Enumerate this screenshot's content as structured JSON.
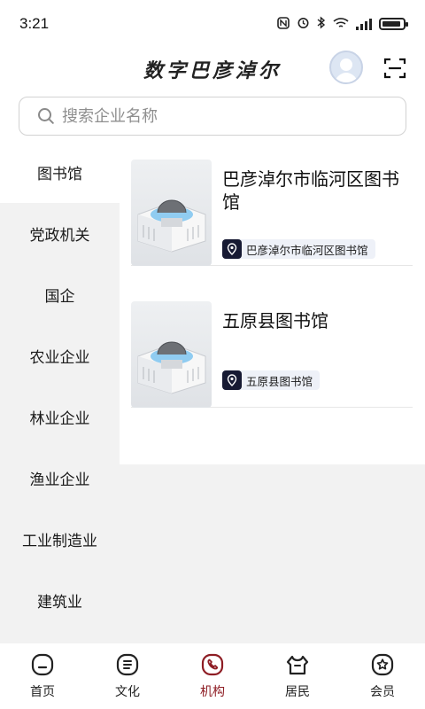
{
  "status_bar": {
    "time": "3:21",
    "battery_level": 0.9
  },
  "header": {
    "title": "数字巴彦淖尔"
  },
  "search": {
    "placeholder": "搜索企业名称"
  },
  "sidebar": {
    "items": [
      {
        "label": "图书馆",
        "active": true
      },
      {
        "label": "党政机关"
      },
      {
        "label": "国企"
      },
      {
        "label": "农业企业"
      },
      {
        "label": "林业企业"
      },
      {
        "label": "渔业企业"
      },
      {
        "label": "工业制造业"
      },
      {
        "label": "建筑业"
      }
    ]
  },
  "list": {
    "items": [
      {
        "title": "巴彦淖尔市临河区图书馆",
        "tag": "巴彦淖尔市临河区图书馆",
        "image": "library-building-image"
      },
      {
        "title": "五原县图书馆",
        "tag": "五原县图书馆",
        "image": "library-building-image"
      }
    ]
  },
  "bottom_nav": {
    "items": [
      {
        "label": "首页",
        "icon": "home-icon"
      },
      {
        "label": "文化",
        "icon": "document-icon"
      },
      {
        "label": "机构",
        "icon": "phone-icon",
        "active": true
      },
      {
        "label": "居民",
        "icon": "resident-icon"
      },
      {
        "label": "会员",
        "icon": "member-star-icon"
      }
    ]
  },
  "colors": {
    "accent": "#8e1d24",
    "sidebar_bg": "#f2f2f2",
    "tag_bg": "#eef1f8",
    "pin_bg": "#171a33"
  }
}
